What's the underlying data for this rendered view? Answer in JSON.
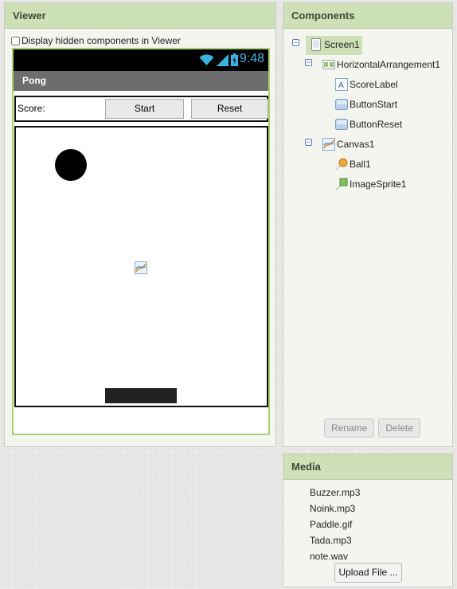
{
  "viewer": {
    "title": "Viewer",
    "hidden_checkbox_label": "Display hidden components in Viewer",
    "hidden_checked": false,
    "phone": {
      "clock": "9:48",
      "app_title": "Pong",
      "score_label": "Score:",
      "start_button": "Start",
      "reset_button": "Reset",
      "status_icons": [
        "wifi-icon",
        "signal-icon",
        "battery-icon"
      ],
      "colors": {
        "statusbar": "#000000",
        "clock": "#33b5e5",
        "titlebar": "#6d6d6d",
        "frame": "#a6d171"
      }
    }
  },
  "components": {
    "title": "Components",
    "tree": [
      {
        "label": "Screen1",
        "icon": "screen-icon",
        "level": 0,
        "selected": true,
        "collapsible": true
      },
      {
        "label": "HorizontalArrangement1",
        "icon": "horizontal-arrangement-icon",
        "level": 1,
        "collapsible": true
      },
      {
        "label": "ScoreLabel",
        "icon": "label-icon",
        "level": 2
      },
      {
        "label": "ButtonStart",
        "icon": "button-icon",
        "level": 2
      },
      {
        "label": "ButtonReset",
        "icon": "button-icon",
        "level": 2
      },
      {
        "label": "Canvas1",
        "icon": "canvas-icon",
        "level": 1,
        "collapsible": true
      },
      {
        "label": "Ball1",
        "icon": "ball-icon",
        "level": 2
      },
      {
        "label": "ImageSprite1",
        "icon": "image-sprite-icon",
        "level": 2
      }
    ],
    "rename_button": "Rename",
    "delete_button": "Delete"
  },
  "media": {
    "title": "Media",
    "files": [
      "Buzzer.mp3",
      "Noink.mp3",
      "Paddle.gif",
      "Tada.mp3",
      "note.wav"
    ],
    "upload_button": "Upload File ..."
  }
}
